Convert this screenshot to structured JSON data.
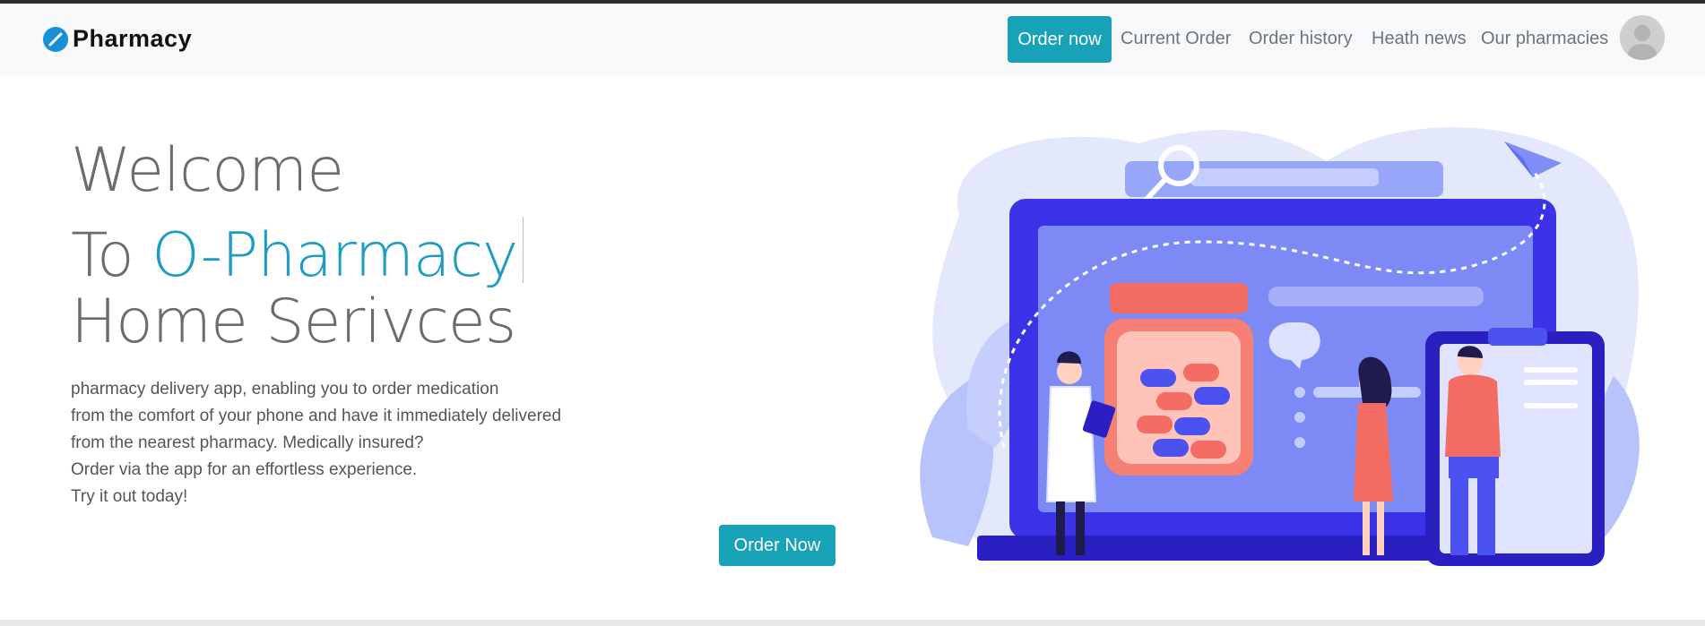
{
  "brand": {
    "name": "Pharmacy",
    "logo_icon": "pharmacy-slash-logo"
  },
  "nav": {
    "order_now": "Order now",
    "links": [
      "Current Order",
      "Order history",
      "Heath news",
      "Our pharmacies"
    ],
    "avatar_icon": "user-avatar"
  },
  "hero": {
    "line1": "Welcome",
    "line2_prefix": "To ",
    "line2_accent": "O-Pharmacy",
    "line3": "Home Serivces",
    "description": [
      "pharmacy delivery app, enabling you to order medication",
      "from the comfort of your phone and have it immediately delivered",
      "from the nearest pharmacy. Medically insured?",
      "Order via the app for an effortless experience.",
      "Try it out today!"
    ],
    "cta": "Order Now",
    "illustration": "online-pharmacy-illustration"
  },
  "colors": {
    "accent": "#17a2b8",
    "title_accent": "#1c9cc7",
    "illustration_primary": "#4b3ff0"
  }
}
